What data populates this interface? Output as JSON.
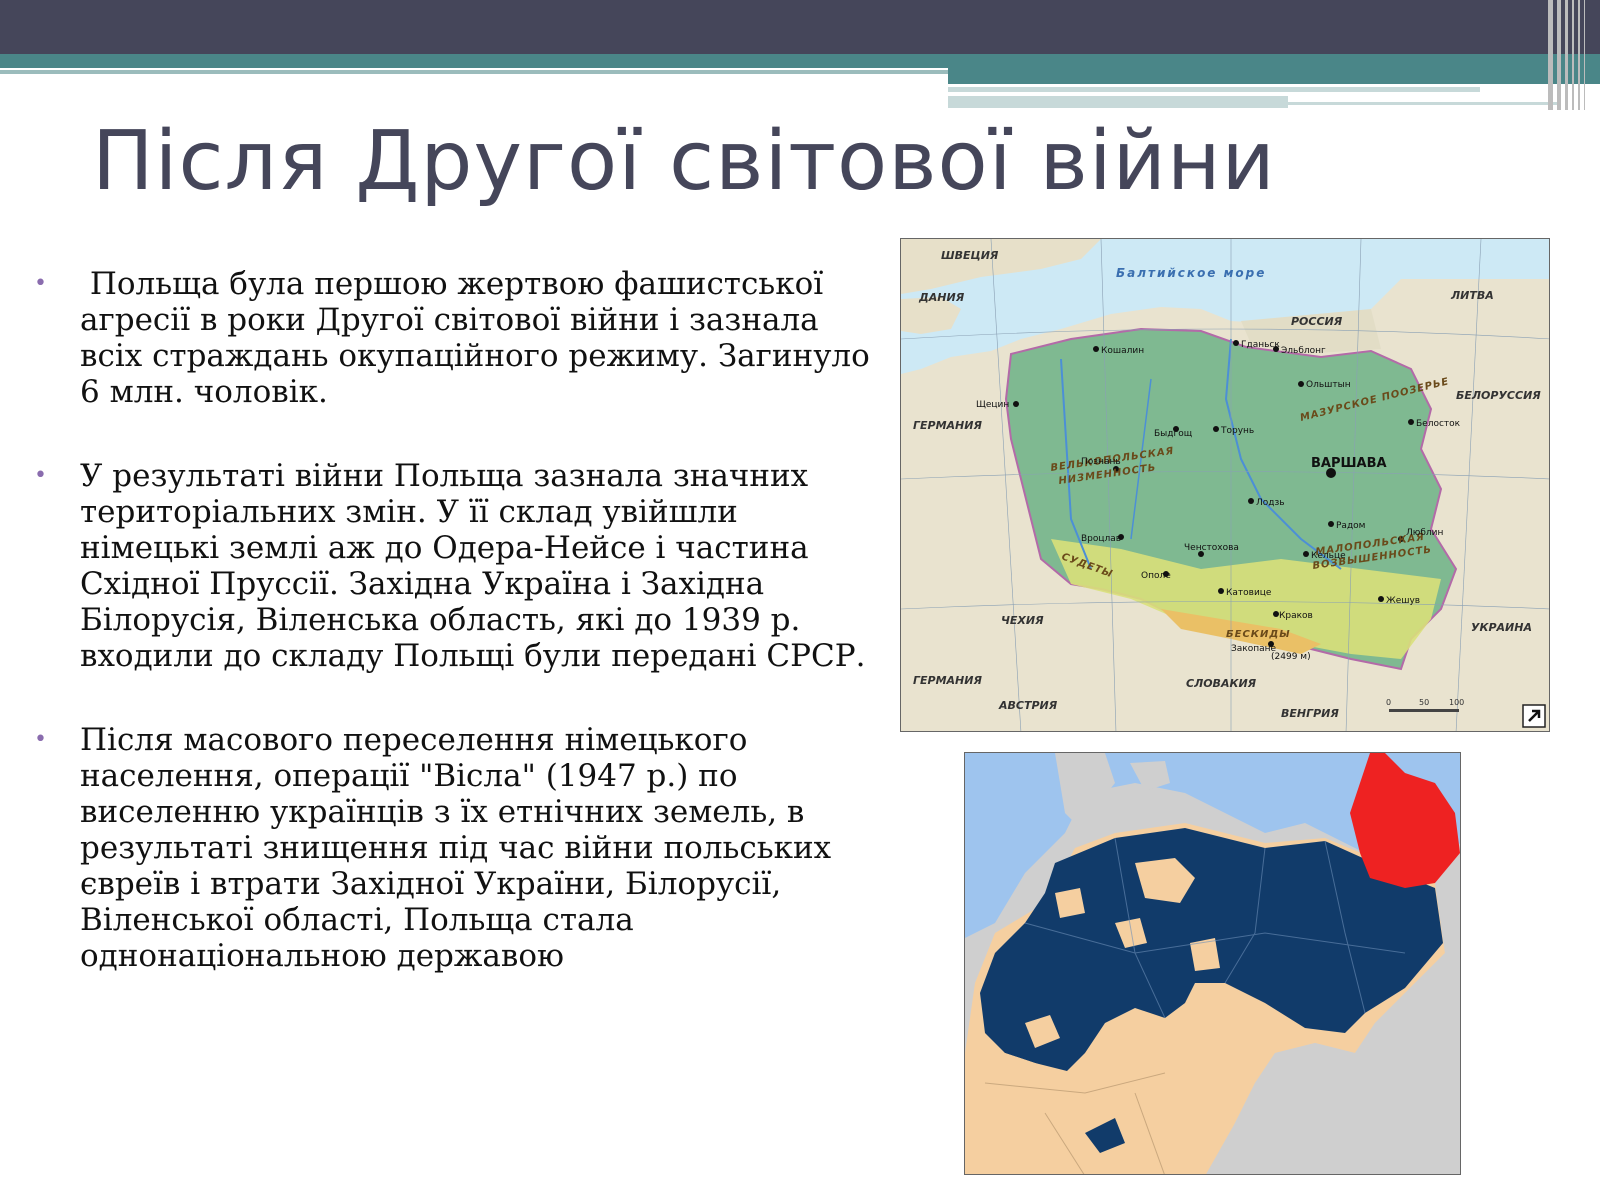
{
  "slide": {
    "title": "Після Другої світової війни",
    "bullets": [
      {
        "text": " Польща була першою жертвою фашистської агресії в роки Другої світової війни і зазнала всіх страждань окупаційного режиму. Загинуло 6 млн. чоловік."
      },
      {
        "text": "У результаті війни Польща зазнала значних територіальних змін. У її склад увійшли німецькі землі аж до Одера-Нейсе і частина Східної Пруссії. Західна Україна і Західна Білорусія, Віленська область, які до 1939 р. входили до складу Польщі були передані СРСР."
      },
      {
        "text": "Після масового переселення  німецького  населення, операції \"Вісла\"  (1947 р.) по виселенню українців з їх етнічних земель, в результаті знищення під час війни польських євреїв і втрати Західної України, Білорусії, Віленської області, Польща стала однонаціональною державою"
      }
    ]
  },
  "map_poland": {
    "sea_label": "Балтийское море",
    "countries": {
      "sweden": "ШВЕЦИЯ",
      "denmark": "ДАНИЯ",
      "russia": "РОССИЯ",
      "lithuania": "ЛИТВА",
      "belarus": "БЕЛОРУССИЯ",
      "germany_n": "ГЕРМАНИЯ",
      "germany_s": "ГЕРМАНИЯ",
      "czechia": "ЧЕХИЯ",
      "slovakia": "СЛОВАКИЯ",
      "ukraine": "УКРАИНА",
      "austria": "АВСТРИЯ",
      "hungary": "ВЕНГРИЯ"
    },
    "regions": {
      "masuria": "МАЗУРСКОЕ ПООЗЕРЬЕ",
      "wielkopolska_1": "ВЕЛЬКОПОЛЬСКАЯ",
      "wielkopolska_2": "НИЗМЕННОСТЬ",
      "sudetes": "СУДЕТЫ",
      "malopolska_1": "МАЛОПОЛЬСКАЯ",
      "malopolska_2": "ВОЗВЫШЕННОСТЬ",
      "beskids": "БЕСКИДЫ"
    },
    "capital": "ВАРШАВА",
    "cities": {
      "gdansk": "Гданьск",
      "szczecin": "Щецин",
      "poznan": "Познань",
      "bydgoszcz": "Быдгощ",
      "torun": "Торунь",
      "olsztyn": "Ольштын",
      "bialystok": "Белосток",
      "lodz": "Лодзь",
      "wroclaw": "Вроцлав",
      "katowice": "Катовице",
      "krakow": "Краков",
      "lublin": "Люблин",
      "radom": "Радом",
      "kielce": "Кельце",
      "rzeszow": "Жешув",
      "czestochowa": "Ченстохова",
      "koszalin": "Кошалин",
      "elblag": "Эльблонг",
      "opole": "Ополе",
      "zakopane": "Закопане"
    },
    "peak": "(2499 м)",
    "scale": [
      "0",
      "50",
      "100"
    ]
  },
  "colors": {
    "header_dark": "#45465a",
    "header_teal": "#4a8688",
    "bullet_marker": "#8a6cae",
    "map2_water": "#9ec4ee",
    "map2_prussia": "#113b6a",
    "map2_other": "#f5cfa0",
    "map2_red": "#ee2222",
    "map2_neighbors": "#cfcfcf"
  }
}
